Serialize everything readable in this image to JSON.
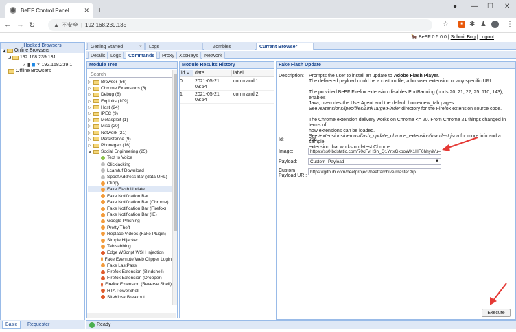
{
  "browser": {
    "tab_title": "BeEF Control Panel",
    "new_tab": "+",
    "insecure": "不安全",
    "url": "192.168.239.135"
  },
  "beef_header": {
    "brand": "BeEF",
    "version": "0.5.0.0",
    "sep1": "|",
    "submit_bug": "Submit Bug",
    "sep2": "|",
    "logout": "Logout"
  },
  "left_panel": {
    "title": "Hooked Browsers",
    "online": "Online Browsers",
    "host": "192.168.239.131",
    "client": "192.168.239.1",
    "offline": "Offline Browsers",
    "bottom_tabs": [
      "Basic",
      "Requester"
    ]
  },
  "main_tabs": [
    "Getting Started",
    "Logs",
    "Zombies",
    "Current Browser"
  ],
  "sub_tabs": [
    "Details",
    "Logs",
    "Commands",
    "Proxy",
    "XssRays",
    "Network"
  ],
  "module_tree": {
    "title": "Module Tree",
    "search_placeholder": "Search",
    "categories": [
      "Browser (56)",
      "Chrome Extensions (6)",
      "Debug (8)",
      "Exploits (109)",
      "Host (24)",
      "IPEC (9)",
      "Metasploit (1)",
      "Misc (20)",
      "Network (21)",
      "Persistence (9)",
      "Phonegap (16)",
      "Social Engineering (25)"
    ],
    "modules": [
      {
        "label": "Text to Voice",
        "color": "#8bc34a"
      },
      {
        "label": "Clickjacking",
        "color": "#bdbdbd"
      },
      {
        "label": "Lcamtuf Download",
        "color": "#bdbdbd"
      },
      {
        "label": "Spoof Address Bar (data URL)",
        "color": "#bdbdbd"
      },
      {
        "label": "Clippy",
        "color": "#f39c3c"
      },
      {
        "label": "Fake Flash Update",
        "color": "#f39c3c"
      },
      {
        "label": "Fake Notification Bar",
        "color": "#f39c3c"
      },
      {
        "label": "Fake Notification Bar (Chrome)",
        "color": "#f39c3c"
      },
      {
        "label": "Fake Notification Bar (Firefox)",
        "color": "#f39c3c"
      },
      {
        "label": "Fake Notification Bar (IE)",
        "color": "#f39c3c"
      },
      {
        "label": "Google Phishing",
        "color": "#f39c3c"
      },
      {
        "label": "Pretty Theft",
        "color": "#f39c3c"
      },
      {
        "label": "Replace Videos (Fake Plugin)",
        "color": "#f39c3c"
      },
      {
        "label": "Simple Hijacker",
        "color": "#f39c3c"
      },
      {
        "label": "TabNabbing",
        "color": "#f39c3c"
      },
      {
        "label": "Edge WScript WSH Injection",
        "color": "#e05a2b"
      },
      {
        "label": "Fake Evernote Web Clipper Login",
        "color": "#f39c3c"
      },
      {
        "label": "Fake LastPass",
        "color": "#f39c3c"
      },
      {
        "label": "Firefox Extension (Bindshell)",
        "color": "#e05a2b"
      },
      {
        "label": "Firefox Extension (Dropper)",
        "color": "#e05a2b"
      },
      {
        "label": "Firefox Extension (Reverse Shell)",
        "color": "#e05a2b"
      },
      {
        "label": "HTA PowerShell",
        "color": "#e05a2b"
      },
      {
        "label": "SiteKiosk Breakout",
        "color": "#e05a2b"
      }
    ]
  },
  "results": {
    "title": "Module Results History",
    "headers": [
      "id",
      "date",
      "label"
    ],
    "rows": [
      {
        "id": "0",
        "date": "2021-05-21 03:54",
        "label": "command 1"
      },
      {
        "id": "1",
        "date": "2021-05-21 03:54",
        "label": "command 2"
      }
    ]
  },
  "details": {
    "title": "Fake Flash Update",
    "description_label": "Description:",
    "desc_p1a": "Prompts the user to install an update to",
    "desc_p1b": "Adobe Flash Player",
    "desc_p1c": ".",
    "desc_p1d": "The delivered payload could be a custom file, a browser extension or any specific URI.",
    "desc_p2a": "The provided BeEF Firefox extension disables PortBanning (ports 20, 21, 22, 25, 110, 143), enables",
    "desc_p2b": "Java, overrides the UserAgent and the default home/new_tab pages.",
    "desc_p2c_pre": "See",
    "desc_p2c_path": "/extensions/ipec/files/LinkTargetFinder",
    "desc_p2c_post": "directory for the Firefox extension source code.",
    "desc_p3a": "The Chrome extension delivery works on Chrome <= 20. From Chrome 21 things changed in terms of",
    "desc_p3b": "how extensions can be loaded.",
    "desc_p3c_pre": "See",
    "desc_p3c_path": "/extensions/demos/flash_update_chrome_extension/manifest.json",
    "desc_p3c_post": "for more info and a sample",
    "desc_p3d": "extension that works on latest Chrome.",
    "id_label": "Id:",
    "id_value": "256",
    "image_label": "Image:",
    "image_value": "https://ss0.bdstatic.com/70cFvHSh_Q1YnxGkpoWK1HF6hhy/it/u=3",
    "payload_label": "Payload:",
    "payload_value": "Custom_Payload",
    "uri_label1": "Custom",
    "uri_label2": "Payload URI:",
    "uri_value": "https://github.com/beefproject/beef/archive/master.zip",
    "execute": "Execute"
  },
  "status": {
    "text": "Ready"
  }
}
